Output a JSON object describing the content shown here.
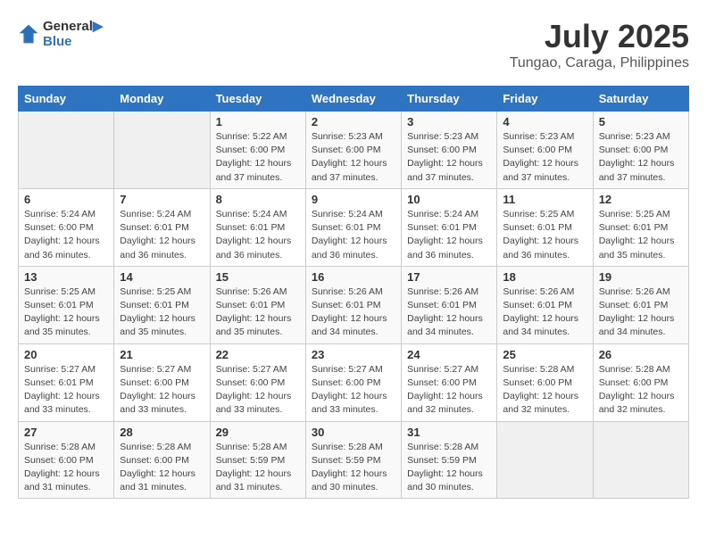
{
  "header": {
    "logo_line1": "General",
    "logo_line2": "Blue",
    "title": "July 2025",
    "subtitle": "Tungao, Caraga, Philippines"
  },
  "days_of_week": [
    "Sunday",
    "Monday",
    "Tuesday",
    "Wednesday",
    "Thursday",
    "Friday",
    "Saturday"
  ],
  "weeks": [
    [
      {
        "day": "",
        "info": ""
      },
      {
        "day": "",
        "info": ""
      },
      {
        "day": "1",
        "info": "Sunrise: 5:22 AM\nSunset: 6:00 PM\nDaylight: 12 hours and 37 minutes."
      },
      {
        "day": "2",
        "info": "Sunrise: 5:23 AM\nSunset: 6:00 PM\nDaylight: 12 hours and 37 minutes."
      },
      {
        "day": "3",
        "info": "Sunrise: 5:23 AM\nSunset: 6:00 PM\nDaylight: 12 hours and 37 minutes."
      },
      {
        "day": "4",
        "info": "Sunrise: 5:23 AM\nSunset: 6:00 PM\nDaylight: 12 hours and 37 minutes."
      },
      {
        "day": "5",
        "info": "Sunrise: 5:23 AM\nSunset: 6:00 PM\nDaylight: 12 hours and 37 minutes."
      }
    ],
    [
      {
        "day": "6",
        "info": "Sunrise: 5:24 AM\nSunset: 6:00 PM\nDaylight: 12 hours and 36 minutes."
      },
      {
        "day": "7",
        "info": "Sunrise: 5:24 AM\nSunset: 6:01 PM\nDaylight: 12 hours and 36 minutes."
      },
      {
        "day": "8",
        "info": "Sunrise: 5:24 AM\nSunset: 6:01 PM\nDaylight: 12 hours and 36 minutes."
      },
      {
        "day": "9",
        "info": "Sunrise: 5:24 AM\nSunset: 6:01 PM\nDaylight: 12 hours and 36 minutes."
      },
      {
        "day": "10",
        "info": "Sunrise: 5:24 AM\nSunset: 6:01 PM\nDaylight: 12 hours and 36 minutes."
      },
      {
        "day": "11",
        "info": "Sunrise: 5:25 AM\nSunset: 6:01 PM\nDaylight: 12 hours and 36 minutes."
      },
      {
        "day": "12",
        "info": "Sunrise: 5:25 AM\nSunset: 6:01 PM\nDaylight: 12 hours and 35 minutes."
      }
    ],
    [
      {
        "day": "13",
        "info": "Sunrise: 5:25 AM\nSunset: 6:01 PM\nDaylight: 12 hours and 35 minutes."
      },
      {
        "day": "14",
        "info": "Sunrise: 5:25 AM\nSunset: 6:01 PM\nDaylight: 12 hours and 35 minutes."
      },
      {
        "day": "15",
        "info": "Sunrise: 5:26 AM\nSunset: 6:01 PM\nDaylight: 12 hours and 35 minutes."
      },
      {
        "day": "16",
        "info": "Sunrise: 5:26 AM\nSunset: 6:01 PM\nDaylight: 12 hours and 34 minutes."
      },
      {
        "day": "17",
        "info": "Sunrise: 5:26 AM\nSunset: 6:01 PM\nDaylight: 12 hours and 34 minutes."
      },
      {
        "day": "18",
        "info": "Sunrise: 5:26 AM\nSunset: 6:01 PM\nDaylight: 12 hours and 34 minutes."
      },
      {
        "day": "19",
        "info": "Sunrise: 5:26 AM\nSunset: 6:01 PM\nDaylight: 12 hours and 34 minutes."
      }
    ],
    [
      {
        "day": "20",
        "info": "Sunrise: 5:27 AM\nSunset: 6:01 PM\nDaylight: 12 hours and 33 minutes."
      },
      {
        "day": "21",
        "info": "Sunrise: 5:27 AM\nSunset: 6:00 PM\nDaylight: 12 hours and 33 minutes."
      },
      {
        "day": "22",
        "info": "Sunrise: 5:27 AM\nSunset: 6:00 PM\nDaylight: 12 hours and 33 minutes."
      },
      {
        "day": "23",
        "info": "Sunrise: 5:27 AM\nSunset: 6:00 PM\nDaylight: 12 hours and 33 minutes."
      },
      {
        "day": "24",
        "info": "Sunrise: 5:27 AM\nSunset: 6:00 PM\nDaylight: 12 hours and 32 minutes."
      },
      {
        "day": "25",
        "info": "Sunrise: 5:28 AM\nSunset: 6:00 PM\nDaylight: 12 hours and 32 minutes."
      },
      {
        "day": "26",
        "info": "Sunrise: 5:28 AM\nSunset: 6:00 PM\nDaylight: 12 hours and 32 minutes."
      }
    ],
    [
      {
        "day": "27",
        "info": "Sunrise: 5:28 AM\nSunset: 6:00 PM\nDaylight: 12 hours and 31 minutes."
      },
      {
        "day": "28",
        "info": "Sunrise: 5:28 AM\nSunset: 6:00 PM\nDaylight: 12 hours and 31 minutes."
      },
      {
        "day": "29",
        "info": "Sunrise: 5:28 AM\nSunset: 5:59 PM\nDaylight: 12 hours and 31 minutes."
      },
      {
        "day": "30",
        "info": "Sunrise: 5:28 AM\nSunset: 5:59 PM\nDaylight: 12 hours and 30 minutes."
      },
      {
        "day": "31",
        "info": "Sunrise: 5:28 AM\nSunset: 5:59 PM\nDaylight: 12 hours and 30 minutes."
      },
      {
        "day": "",
        "info": ""
      },
      {
        "day": "",
        "info": ""
      }
    ]
  ]
}
